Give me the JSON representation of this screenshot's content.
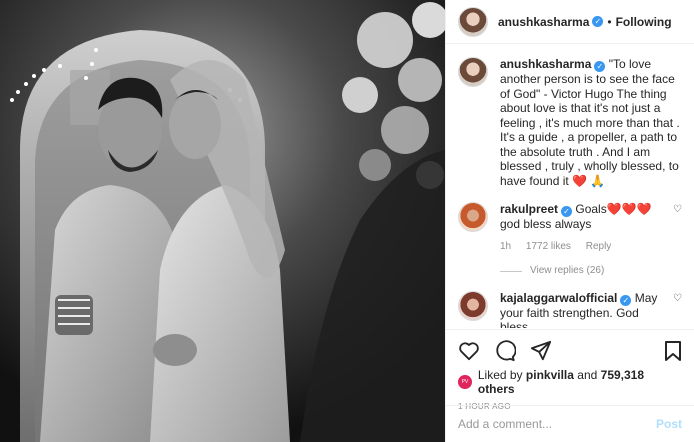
{
  "header": {
    "username": "anushkasharma",
    "separator": "•",
    "follow_label": "Following"
  },
  "caption": {
    "username": "anushkasharma",
    "text": "\"To love another person is to see the face of God\" - Victor Hugo The thing about love is that it's not just a feeling , it's much more than that . It's a guide , a propeller, a path to the absolute truth . And I am blessed , truly , wholly blessed, to have found it ❤️ 🙏"
  },
  "comments": [
    {
      "username": "rakulpreet",
      "text": "Goals❤️❤️❤️ god bless always",
      "age": "1h",
      "likes": "1772 likes",
      "reply": "Reply",
      "view_replies": "View replies (26)"
    },
    {
      "username": "kajalaggarwalofficial",
      "text": "May your faith strengthen. God bless"
    }
  ],
  "likes": {
    "prefix": "Liked by",
    "by": "pinkvilla",
    "and": "and",
    "count": "759,318 others"
  },
  "timestamp": "1 HOUR AGO",
  "add_comment": {
    "placeholder": "Add a comment...",
    "post_label": "Post"
  },
  "icons": {
    "verified": "verified-badge-icon",
    "heart": "heart-icon",
    "comment": "comment-icon",
    "share": "share-icon",
    "save": "bookmark-icon"
  },
  "colors": {
    "verified": "#3897f0",
    "post_disabled": "#b2dffc",
    "muted": "#8e8e8e"
  }
}
